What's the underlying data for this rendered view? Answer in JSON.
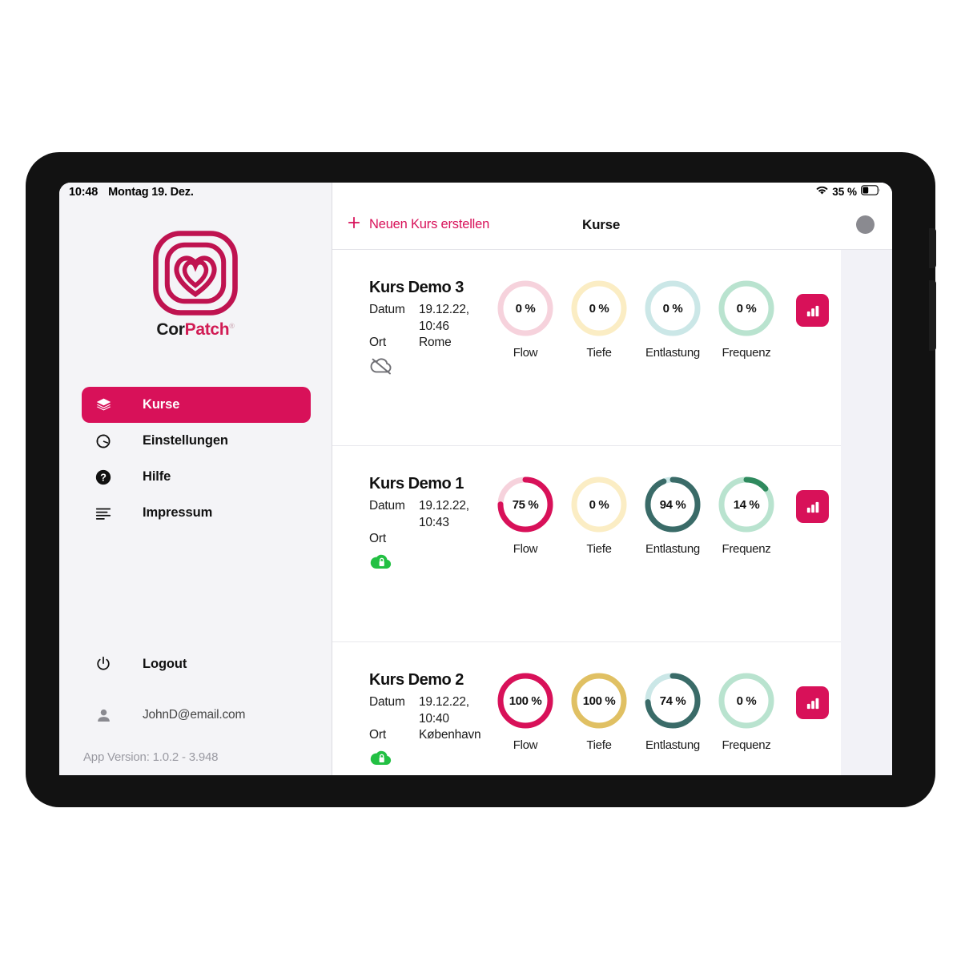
{
  "status_bar": {
    "time": "10:48",
    "date": "Montag 19. Dez.",
    "battery_text": "35 %",
    "wifi_icon": "wifi-icon",
    "battery_icon": "battery-icon"
  },
  "brand": {
    "logo_icon": "corpatch-heart-logo",
    "name_part1": "Cor",
    "name_part2": "Patch",
    "registered": "®"
  },
  "sidebar": {
    "items": [
      {
        "label": "Kurse",
        "icon": "layers-icon",
        "active": true
      },
      {
        "label": "Einstellungen",
        "icon": "gear-icon",
        "active": false
      },
      {
        "label": "Hilfe",
        "icon": "question-circle-icon",
        "active": false
      },
      {
        "label": "Impressum",
        "icon": "list-lines-icon",
        "active": false
      }
    ],
    "logout": {
      "label": "Logout",
      "icon": "power-icon"
    },
    "user": {
      "email": "JohnD@email.com",
      "icon": "person-icon"
    },
    "app_version": "App Version: 1.0.2 - 3.948"
  },
  "toolbar": {
    "new_course_label": "Neuen Kurs erstellen",
    "new_course_icon": "plus-icon",
    "title": "Kurse",
    "avatar_icon": "avatar-circle"
  },
  "colors": {
    "accent": "#d81159",
    "flow_track": "#f6d2dc",
    "flow_fill": "#d81159",
    "tiefe_track": "#fbedc4",
    "tiefe_fill": "#e0c063",
    "entlastung_track": "#cbe7e7",
    "entlastung_fill": "#3a6b68",
    "frequenz_track": "#b9e3cf",
    "frequenz_fill": "#2f8a5e",
    "cloud_synced": "#22c043",
    "cloud_offline": "#6e6e73"
  },
  "courses": [
    {
      "title": "Kurs Demo 3",
      "date_key": "Datum",
      "date_value": "19.12.22, 10:46",
      "place_key": "Ort",
      "place_value": "Rome",
      "sync_icon": "cloud-off-icon",
      "sync_state": "offline",
      "chart_button_icon": "bar-chart-icon",
      "metrics": [
        {
          "label": "Flow",
          "value": 0,
          "display": "0 %"
        },
        {
          "label": "Tiefe",
          "value": 0,
          "display": "0 %"
        },
        {
          "label": "Entlastung",
          "value": 0,
          "display": "0 %"
        },
        {
          "label": "Frequenz",
          "value": 0,
          "display": "0 %"
        }
      ]
    },
    {
      "title": "Kurs Demo 1",
      "date_key": "Datum",
      "date_value": "19.12.22, 10:43",
      "place_key": "Ort",
      "place_value": "",
      "sync_icon": "cloud-lock-icon",
      "sync_state": "synced",
      "chart_button_icon": "bar-chart-icon",
      "metrics": [
        {
          "label": "Flow",
          "value": 75,
          "display": "75 %"
        },
        {
          "label": "Tiefe",
          "value": 0,
          "display": "0 %"
        },
        {
          "label": "Entlastung",
          "value": 94,
          "display": "94 %"
        },
        {
          "label": "Frequenz",
          "value": 14,
          "display": "14 %"
        }
      ]
    },
    {
      "title": "Kurs Demo 2",
      "date_key": "Datum",
      "date_value": "19.12.22, 10:40",
      "place_key": "Ort",
      "place_value": "København",
      "sync_icon": "cloud-lock-icon",
      "sync_state": "synced",
      "chart_button_icon": "bar-chart-icon",
      "metrics": [
        {
          "label": "Flow",
          "value": 100,
          "display": "100 %"
        },
        {
          "label": "Tiefe",
          "value": 100,
          "display": "100 %"
        },
        {
          "label": "Entlastung",
          "value": 74,
          "display": "74 %"
        },
        {
          "label": "Frequenz",
          "value": 0,
          "display": "0 %"
        }
      ]
    }
  ]
}
